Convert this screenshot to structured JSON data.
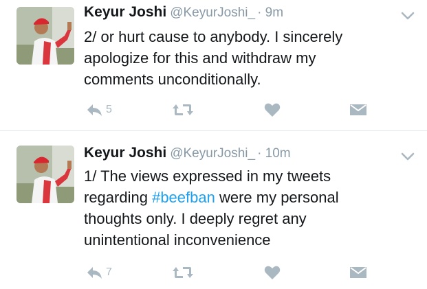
{
  "tweets": [
    {
      "name": "Keyur Joshi",
      "handle": "@KeyurJoshi_",
      "time": "· 9m",
      "lines": [
        "2/ or hurt cause to anybody. I sincerely",
        "apologize for this and withdraw my",
        "comments unconditionally."
      ],
      "reply_count": "5",
      "icons": [
        "reply-icon",
        "retweet-icon",
        "like-icon",
        "dm-icon",
        "chevron-down-icon"
      ]
    },
    {
      "name": "Keyur Joshi",
      "handle": "@KeyurJoshi_",
      "time": "· 10m",
      "line1": "1/ The views expressed in my tweets",
      "line2_before": "regarding ",
      "hashtag": "#beefban",
      "line2_after": " were my personal",
      "line3": "thoughts only. I deeply regret any",
      "line4": "unintentional inconvenience",
      "reply_count": "7",
      "icons": [
        "reply-icon",
        "retweet-icon",
        "like-icon",
        "dm-icon",
        "chevron-down-icon"
      ]
    }
  ],
  "colors": {
    "text": "#14171a",
    "meta": "#8899a6",
    "icon": "#aab8c2",
    "hashtag": "#1da1f2",
    "divider": "#e1e8ed"
  }
}
